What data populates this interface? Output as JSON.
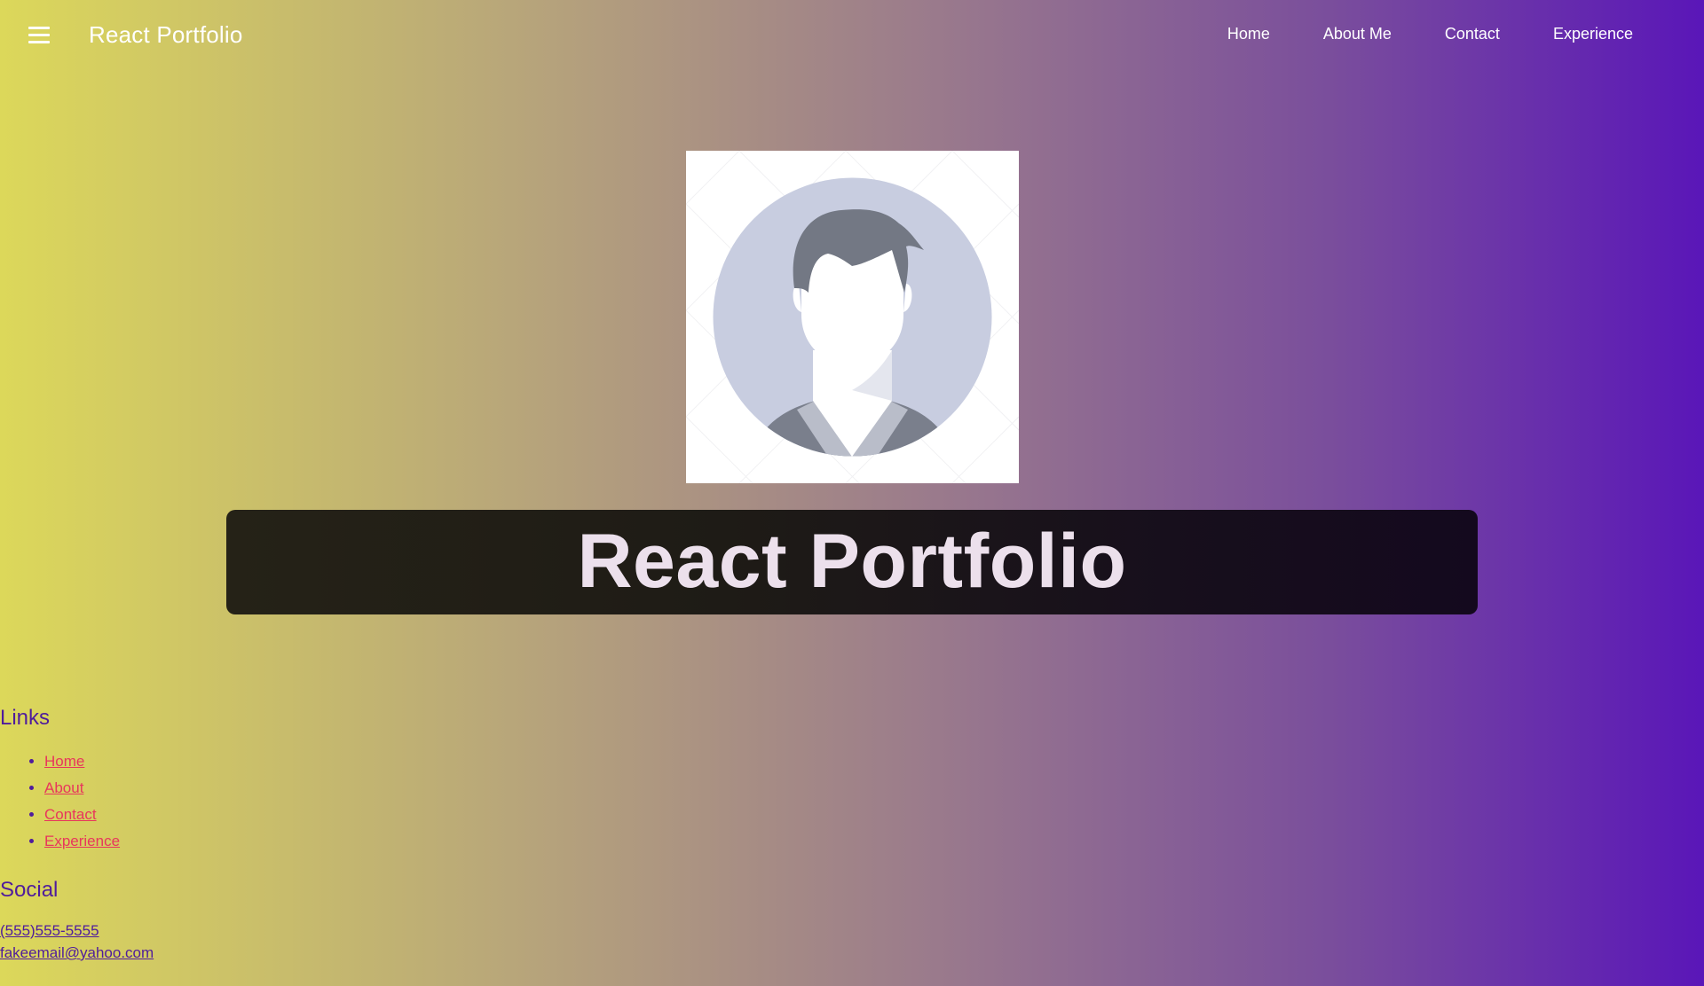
{
  "header": {
    "brand": "React Portfolio",
    "nav": [
      {
        "label": "Home"
      },
      {
        "label": "About Me"
      },
      {
        "label": "Contact"
      },
      {
        "label": "Experience"
      }
    ]
  },
  "hero": {
    "title": "React Portfolio"
  },
  "footer": {
    "links_heading": "Links",
    "links": [
      {
        "label": "Home"
      },
      {
        "label": "About"
      },
      {
        "label": "Contact"
      },
      {
        "label": "Experience"
      }
    ],
    "social_heading": "Social",
    "phone": "(555)555-5555",
    "email": "fakeemail@yahoo.com"
  },
  "colors": {
    "gradient_left": "#dcd85a",
    "gradient_right": "#5a16b8",
    "footer_text": "#4f1c9c",
    "footer_link": "#e8365c"
  },
  "icons": {
    "menu": "hamburger-icon",
    "avatar": "default-avatar-icon"
  }
}
